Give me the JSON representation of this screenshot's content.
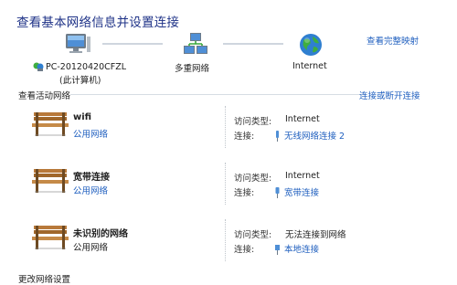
{
  "header": {
    "title": "查看基本网络信息并设置连接",
    "view_full_map": "查看完整映射"
  },
  "map": {
    "computer_name": "PC-20120420CFZL",
    "computer_note": "(此计算机)",
    "middle_label": "多重网络",
    "internet_label": "Internet"
  },
  "active_section": {
    "title": "查看活动网络",
    "connect_link": "连接或断开连接"
  },
  "networks": [
    {
      "name": "wifi",
      "type": "公用网络",
      "type_is_link": true,
      "access_key": "访问类型:",
      "access_value": "Internet",
      "conn_key": "连接:",
      "conn_value": "无线网络连接 2",
      "conn_icon": "wireless-signal-icon"
    },
    {
      "name": "宽带连接",
      "type": "公用网络",
      "type_is_link": true,
      "access_key": "访问类型:",
      "access_value": "Internet",
      "conn_key": "连接:",
      "conn_value": "宽带连接",
      "conn_icon": "broadband-icon"
    },
    {
      "name": "未识别的网络",
      "type": "公用网络",
      "type_is_link": false,
      "access_key": "访问类型:",
      "access_value": "无法连接到网络",
      "conn_key": "连接:",
      "conn_value": "本地连接",
      "conn_icon": "ethernet-icon"
    }
  ],
  "bottom": {
    "title": "更改网络设置"
  },
  "colors": {
    "title": "#1e3287",
    "link": "#1f5fbf",
    "bench_wood": "#a0672b"
  }
}
